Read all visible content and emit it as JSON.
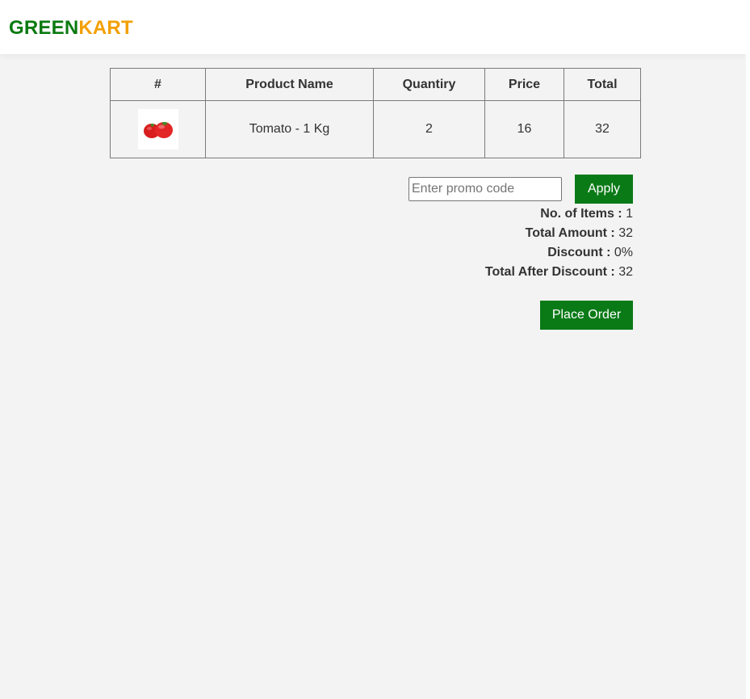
{
  "header": {
    "logo_part1": "GREEN",
    "logo_part2": "KART"
  },
  "colors": {
    "brand_green": "#0a7a10",
    "brand_orange": "#f3a000",
    "button_green": "#0a7a17",
    "page_background": "#f3f3f3"
  },
  "cart_table": {
    "columns": [
      "#",
      "Product Name",
      "Quantiry",
      "Price",
      "Total"
    ],
    "rows": [
      {
        "image_icon": "tomato-image",
        "product_name": "Tomato - 1 Kg",
        "quantity": "2",
        "price": "16",
        "total": "32"
      }
    ]
  },
  "promo": {
    "placeholder": "Enter promo code",
    "value": "",
    "apply_label": "Apply"
  },
  "summary": {
    "items_label": "No. of Items :",
    "items_value": "1",
    "total_amount_label": "Total Amount :",
    "total_amount_value": "32",
    "discount_label": "Discount :",
    "discount_value": "0%",
    "total_after_discount_label": "Total After Discount :",
    "total_after_discount_value": "32"
  },
  "actions": {
    "place_order_label": "Place Order"
  }
}
